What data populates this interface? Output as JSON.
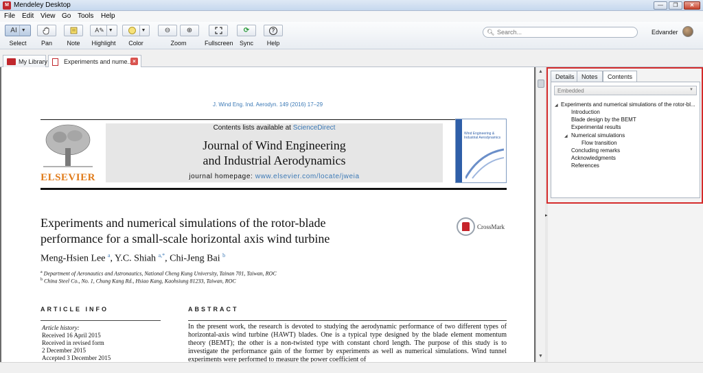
{
  "window": {
    "title": "Mendeley Desktop",
    "app_icon": "M",
    "controls": [
      "—",
      "❐",
      "✕"
    ]
  },
  "menu": [
    "File",
    "Edit",
    "View",
    "Go",
    "Tools",
    "Help"
  ],
  "toolbar": {
    "select": {
      "label": "Select",
      "icon": "AI"
    },
    "pan": {
      "label": "Pan",
      "icon": "hand-icon"
    },
    "note": {
      "label": "Note",
      "icon": "note-icon"
    },
    "highlight": {
      "label": "Highlight",
      "icon": "A✎"
    },
    "color": {
      "label": "Color",
      "swatch": "#f7e27a"
    },
    "zoom": {
      "label": "Zoom",
      "out": "⊖",
      "in": "⊕"
    },
    "fullscreen": {
      "label": "Fullscreen",
      "icon": "fullscreen-icon"
    },
    "sync": {
      "label": "Sync",
      "icon": "⟳"
    },
    "help": {
      "label": "Help",
      "icon": "?"
    }
  },
  "search": {
    "placeholder": "Search..."
  },
  "user": {
    "name": "Edvander"
  },
  "tabs": [
    {
      "label": "My Library"
    },
    {
      "label": "Experiments and nume..."
    }
  ],
  "paper": {
    "citation": "J. Wind Eng. Ind. Aerodyn. 149 (2016) 17–29",
    "contents_prefix": "Contents lists available at ",
    "contents_link": "ScienceDirect",
    "journal_line1": "Journal of Wind Engineering",
    "journal_line2": "and Industrial Aerodynamics",
    "homepage_prefix": "journal homepage: ",
    "homepage_url": "www.elsevier.com/locate/jweia",
    "publisher": "ELSEVIER",
    "cover_text": "Wind Engineering & Industrial Aerodynamics",
    "title_line1": "Experiments and numerical simulations of the rotor-blade",
    "title_line2": "performance for a small-scale horizontal axis wind turbine",
    "crossmark": "CrossMark",
    "author1": "Meng-Hsien Lee",
    "author1_sup": "a",
    "author2": "Y.C. Shiah",
    "author2_sup": "a,",
    "author2_star": "*",
    "author3": "Chi-Jeng Bai",
    "author3_sup": "b",
    "affil_a_sup": "a",
    "affil_a": "Department of Aeronautics and Astronautics, National Cheng Kung University, Tainan 701, Taiwan, ROC",
    "affil_b_sup": "b",
    "affil_b": "China Steel Co., No. 1, Chung Kang Rd., Hsiao Kang, Kaohsiung 81233, Taiwan, ROC",
    "article_info_head": "ARTICLE INFO",
    "abstract_head": "ABSTRACT",
    "history_label": "Article history:",
    "history": [
      "Received 16 April 2015",
      "Received in revised form",
      "2 December 2015",
      "Accepted 3 December 2015"
    ],
    "abstract_text": "In the present work, the research is devoted to studying the aerodynamic performance of two different types of horizontal-axis wind turbine (HAWT) blades. One is a typical type designed by the blade element momentum theory (BEMT); the other is a non-twisted type with constant chord length. The purpose of this study is to investigate the performance gain of the former by experiments as well as numerical simulations. Wind tunnel experiments were performed to measure the power coefficient of"
  },
  "right_panel": {
    "tabs": [
      "Details",
      "Notes",
      "Contents"
    ],
    "active_tab": "Contents",
    "source_select": "Embedded",
    "toc": [
      {
        "label": "Experiments and numerical simulations of the rotor-bl...",
        "level": 0,
        "expanded": true
      },
      {
        "label": "Introduction",
        "level": 1
      },
      {
        "label": "Blade design by the BEMT",
        "level": 1
      },
      {
        "label": "Experimental results",
        "level": 1
      },
      {
        "label": "Numerical simulations",
        "level": 1,
        "expanded": true
      },
      {
        "label": "Flow transition",
        "level": 2
      },
      {
        "label": "Concluding remarks",
        "level": 1
      },
      {
        "label": "Acknowledgments",
        "level": 1
      },
      {
        "label": "References",
        "level": 1
      }
    ]
  },
  "colors": {
    "accent_red": "#d42a2a",
    "link_blue": "#3a78b5",
    "elsevier_orange": "#e07b1a"
  }
}
